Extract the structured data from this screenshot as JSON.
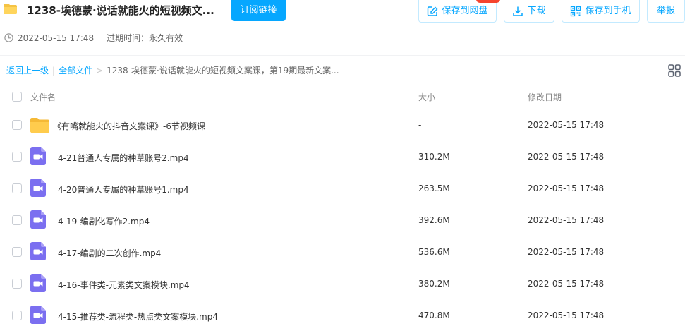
{
  "header": {
    "title": "1238-埃德蒙·说话就能火的短视频文...",
    "subscribe_label": "订阅链接",
    "save_to_disk_label": "保存到网盘",
    "download_label": "下载",
    "save_to_phone_label": "保存到手机",
    "report_label": "举报",
    "accent_color": "#06a7ff"
  },
  "meta": {
    "share_time": "2022-05-15 17:48",
    "expire_text": "过期时间：永久有效"
  },
  "breadcrumb": {
    "back_label": "返回上一级",
    "all_files_label": "全部文件",
    "separator_1": "|",
    "separator_2": ">",
    "current_path": "1238-埃德蒙·说话就能火的短视频文案课，第19期最新文案..."
  },
  "table": {
    "col_name": "文件名",
    "col_size": "大小",
    "col_date": "修改日期",
    "rows": [
      {
        "type": "folder",
        "icon": "folder-icon",
        "name": "《有嘴就能火的抖音文案课》-6节视频课",
        "size": "-",
        "date": "2022-05-15 17:48"
      },
      {
        "type": "video",
        "icon": "video-file-icon",
        "name": "4-21普通人专属的种草账号2.mp4",
        "size": "310.2M",
        "date": "2022-05-15 17:48"
      },
      {
        "type": "video",
        "icon": "video-file-icon",
        "name": "4-20普通人专属的种草账号1.mp4",
        "size": "263.5M",
        "date": "2022-05-15 17:48"
      },
      {
        "type": "video",
        "icon": "video-file-icon",
        "name": "4-19-编剧化写作2.mp4",
        "size": "392.6M",
        "date": "2022-05-15 17:48"
      },
      {
        "type": "video",
        "icon": "video-file-icon",
        "name": "4-17-编剧的二次创作.mp4",
        "size": "536.6M",
        "date": "2022-05-15 17:48"
      },
      {
        "type": "video",
        "icon": "video-file-icon",
        "name": "4-16-事件类-元素类文案模块.mp4",
        "size": "380.2M",
        "date": "2022-05-15 17:48"
      },
      {
        "type": "video",
        "icon": "video-file-icon",
        "name": "4-15-推荐类-流程类-热点类文案模块.mp4",
        "size": "470.8M",
        "date": "2022-05-15 17:48"
      }
    ]
  }
}
